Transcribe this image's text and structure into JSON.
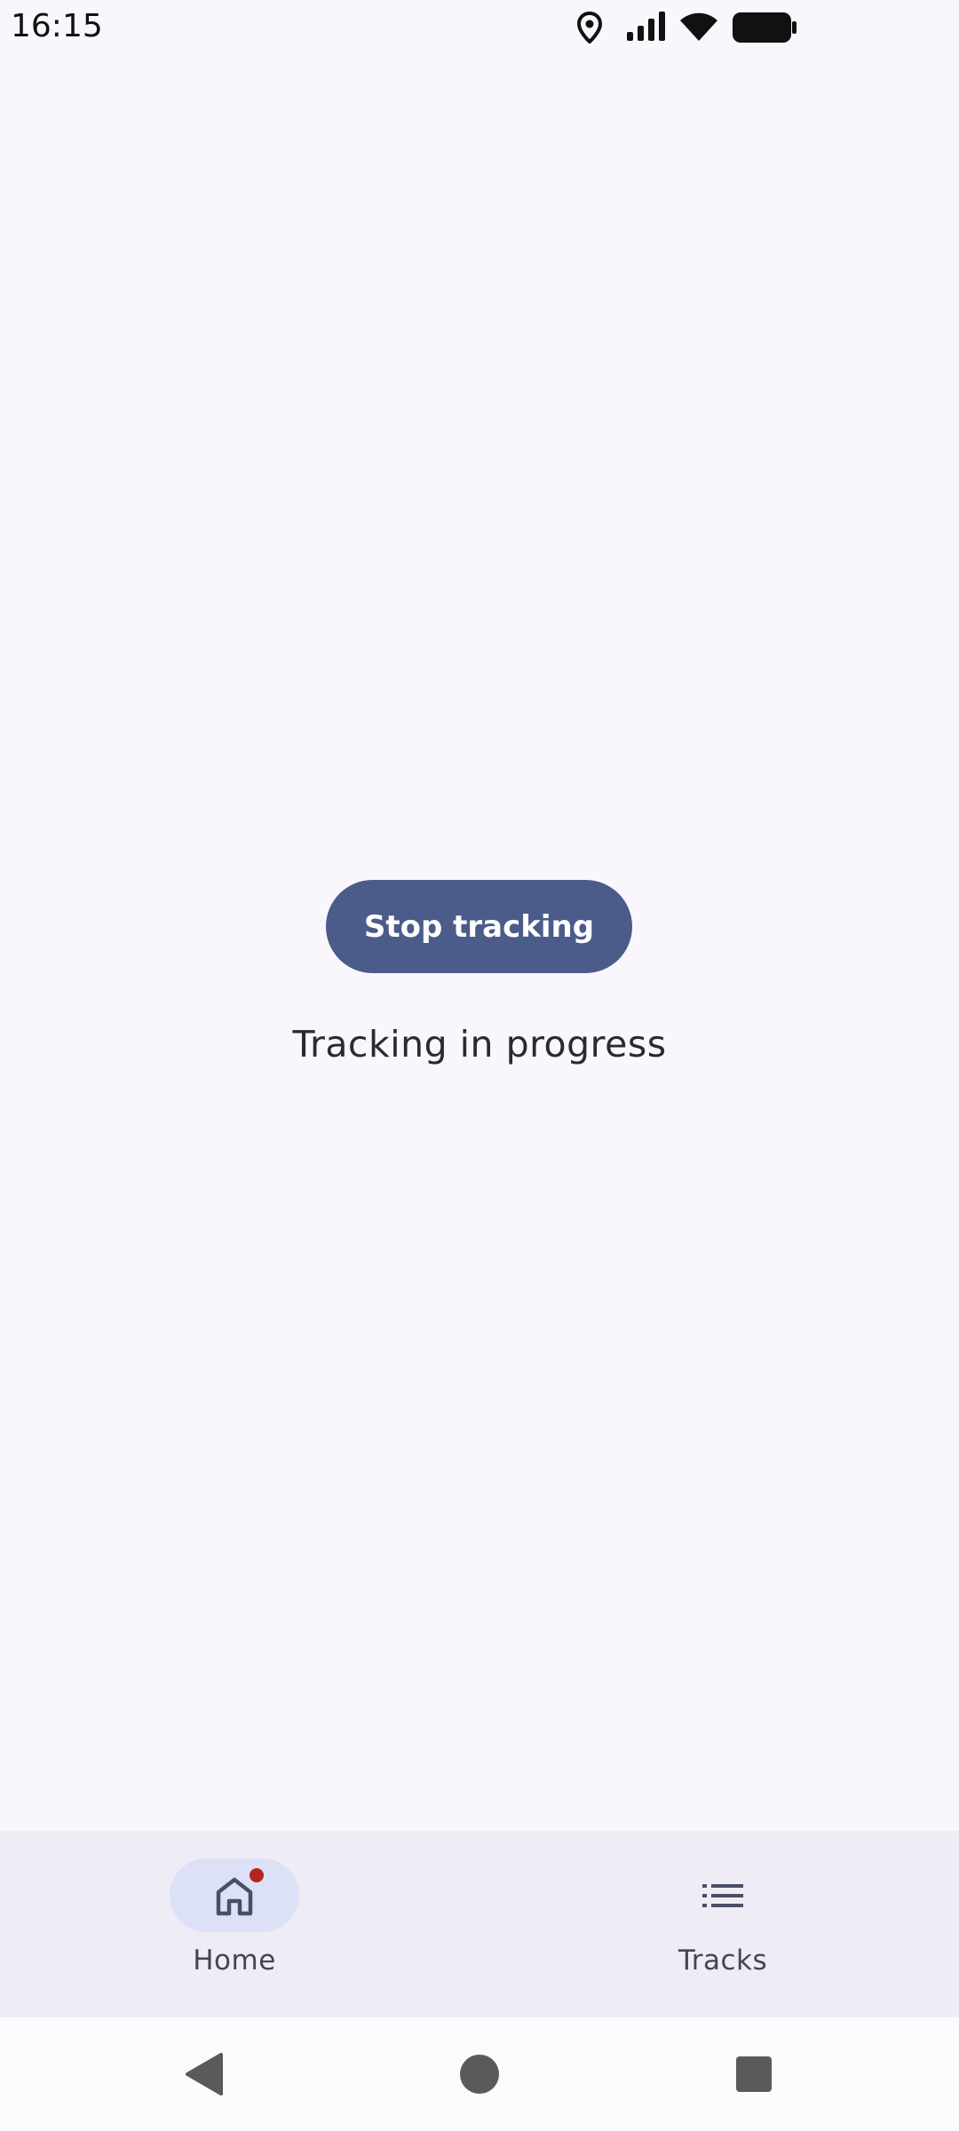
{
  "status_bar": {
    "time": "16:15",
    "icons": [
      "location-icon",
      "signal-icon",
      "wifi-icon",
      "battery-icon"
    ]
  },
  "main": {
    "stop_button_label": "Stop tracking",
    "status_text": "Tracking in progress"
  },
  "bottom_nav": {
    "items": [
      {
        "label": "Home",
        "icon": "home-icon",
        "selected": true,
        "badge": true
      },
      {
        "label": "Tracks",
        "icon": "list-icon",
        "selected": false,
        "badge": false
      }
    ]
  },
  "system_nav": {
    "buttons": [
      "back-icon",
      "home-circle-icon",
      "recents-icon"
    ]
  },
  "colors": {
    "background": "#f9f7fc",
    "primary": "#4b5b8a",
    "nav_background": "#eeedf5",
    "nav_indicator": "#dde1f8",
    "badge": "#b3261e",
    "system_nav_icon": "#5a5a5a"
  }
}
